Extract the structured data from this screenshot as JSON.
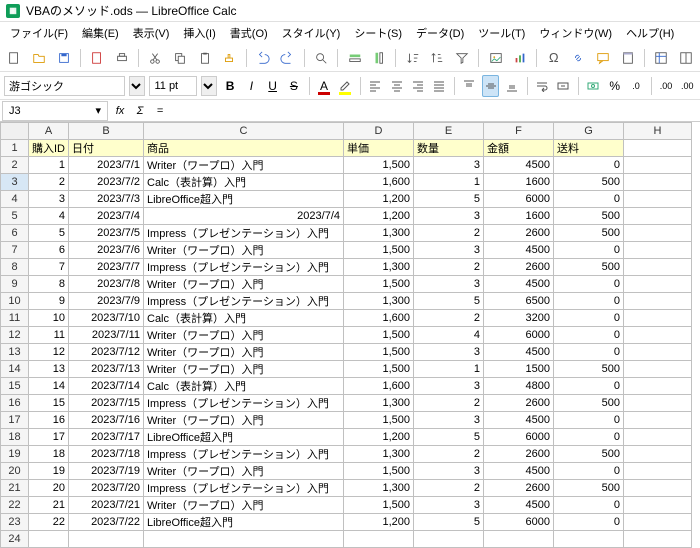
{
  "title": "VBAのメソッド.ods — LibreOffice Calc",
  "menus": [
    "ファイル(F)",
    "編集(E)",
    "表示(V)",
    "挿入(I)",
    "書式(O)",
    "スタイル(Y)",
    "シート(S)",
    "データ(D)",
    "ツール(T)",
    "ウィンドウ(W)",
    "ヘルプ(H)"
  ],
  "font": "游ゴシック",
  "size": "11 pt",
  "nameBox": "J3",
  "fx": "fx",
  "sigma": "Σ",
  "eq": "=",
  "cols": [
    "A",
    "B",
    "C",
    "D",
    "E",
    "F",
    "G",
    "H"
  ],
  "headers": [
    "購入ID",
    "日付",
    "商品",
    "単価",
    "数量",
    "金額",
    "送料"
  ],
  "selectedRow": 3,
  "rows": [
    [
      1,
      "2023/7/1",
      "Writer（ワープロ）入門",
      "1,500",
      "3",
      "4500",
      "0"
    ],
    [
      2,
      "2023/7/2",
      "Calc（表計算）入門",
      "1,600",
      "1",
      "1600",
      "500"
    ],
    [
      3,
      "2023/7/3",
      "LibreOffice超入門",
      "1,200",
      "5",
      "6000",
      "0"
    ],
    [
      4,
      "2023/7/4",
      "2023/7/4",
      "1,200",
      "3",
      "1600",
      "500"
    ],
    [
      5,
      "2023/7/5",
      "Impress（プレゼンテーション）入門",
      "1,300",
      "2",
      "2600",
      "500"
    ],
    [
      6,
      "2023/7/6",
      "Writer（ワープロ）入門",
      "1,500",
      "3",
      "4500",
      "0"
    ],
    [
      7,
      "2023/7/7",
      "Impress（プレゼンテーション）入門",
      "1,300",
      "2",
      "2600",
      "500"
    ],
    [
      8,
      "2023/7/8",
      "Writer（ワープロ）入門",
      "1,500",
      "3",
      "4500",
      "0"
    ],
    [
      9,
      "2023/7/9",
      "Impress（プレゼンテーション）入門",
      "1,300",
      "5",
      "6500",
      "0"
    ],
    [
      10,
      "2023/7/10",
      "Calc（表計算）入門",
      "1,600",
      "2",
      "3200",
      "0"
    ],
    [
      11,
      "2023/7/11",
      "Writer（ワープロ）入門",
      "1,500",
      "4",
      "6000",
      "0"
    ],
    [
      12,
      "2023/7/12",
      "Writer（ワープロ）入門",
      "1,500",
      "3",
      "4500",
      "0"
    ],
    [
      13,
      "2023/7/13",
      "Writer（ワープロ）入門",
      "1,500",
      "1",
      "1500",
      "500"
    ],
    [
      14,
      "2023/7/14",
      "Calc（表計算）入門",
      "1,600",
      "3",
      "4800",
      "0"
    ],
    [
      15,
      "2023/7/15",
      "Impress（プレゼンテーション）入門",
      "1,300",
      "2",
      "2600",
      "500"
    ],
    [
      16,
      "2023/7/16",
      "Writer（ワープロ）入門",
      "1,500",
      "3",
      "4500",
      "0"
    ],
    [
      17,
      "2023/7/17",
      "LibreOffice超入門",
      "1,200",
      "5",
      "6000",
      "0"
    ],
    [
      18,
      "2023/7/18",
      "Impress（プレゼンテーション）入門",
      "1,300",
      "2",
      "2600",
      "500"
    ],
    [
      19,
      "2023/7/19",
      "Writer（ワープロ）入門",
      "1,500",
      "3",
      "4500",
      "0"
    ],
    [
      20,
      "2023/7/20",
      "Impress（プレゼンテーション）入門",
      "1,300",
      "2",
      "2600",
      "500"
    ],
    [
      21,
      "2023/7/21",
      "Writer（ワープロ）入門",
      "1,500",
      "3",
      "4500",
      "0"
    ],
    [
      22,
      "2023/7/22",
      "LibreOffice超入門",
      "1,200",
      "5",
      "6000",
      "0"
    ]
  ],
  "pct": "%",
  "pt": ".0",
  "zero1": ".00",
  "zero2": ".00"
}
